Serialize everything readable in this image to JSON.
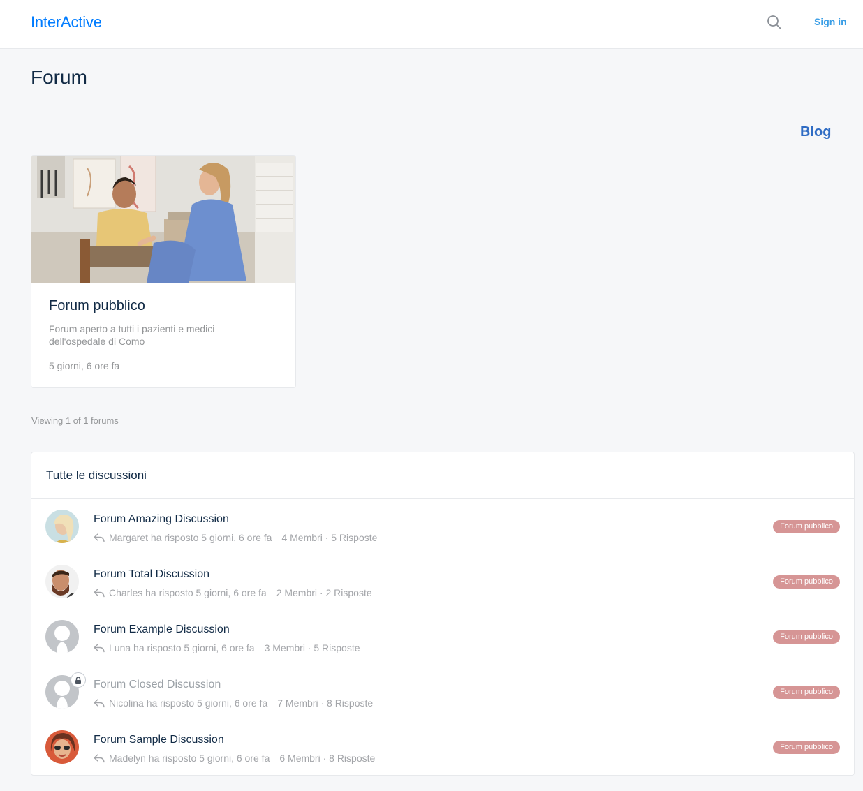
{
  "header": {
    "logo": "InterActive",
    "sign_in": "Sign in"
  },
  "page": {
    "title": "Forum",
    "blog_link": "Blog"
  },
  "forum_card": {
    "title": "Forum pubblico",
    "description": "Forum aperto a tutti i pazienti e medici dell'ospedale di Como",
    "time": "5 giorni, 6 ore fa"
  },
  "viewing_text": "Viewing 1 of 1 forums",
  "discussions": {
    "heading": "Tutte le discussioni",
    "items": [
      {
        "title": "Forum Amazing Discussion",
        "reply": "Margaret ha risposto 5 giorni, 6 ore fa",
        "stats": "4 Membri · 5 Risposte",
        "tag": "Forum pubblico"
      },
      {
        "title": "Forum Total Discussion",
        "reply": "Charles ha risposto 5 giorni, 6 ore fa",
        "stats": "2 Membri · 2 Risposte",
        "tag": "Forum pubblico"
      },
      {
        "title": "Forum Example Discussion",
        "reply": "Luna ha risposto 5 giorni, 6 ore fa",
        "stats": "3 Membri · 5 Risposte",
        "tag": "Forum pubblico"
      },
      {
        "title": "Forum Closed Discussion",
        "reply": "Nicolina ha risposto 5 giorni, 6 ore fa",
        "stats": "7 Membri · 8 Risposte",
        "tag": "Forum pubblico"
      },
      {
        "title": "Forum Sample Discussion",
        "reply": "Madelyn ha risposto 5 giorni, 6 ore fa",
        "stats": "6 Membri · 8 Risposte",
        "tag": "Forum pubblico"
      }
    ]
  },
  "colors": {
    "brand": "#007cff",
    "tag_bg": "#d69595",
    "blog": "#2f6cc4"
  }
}
